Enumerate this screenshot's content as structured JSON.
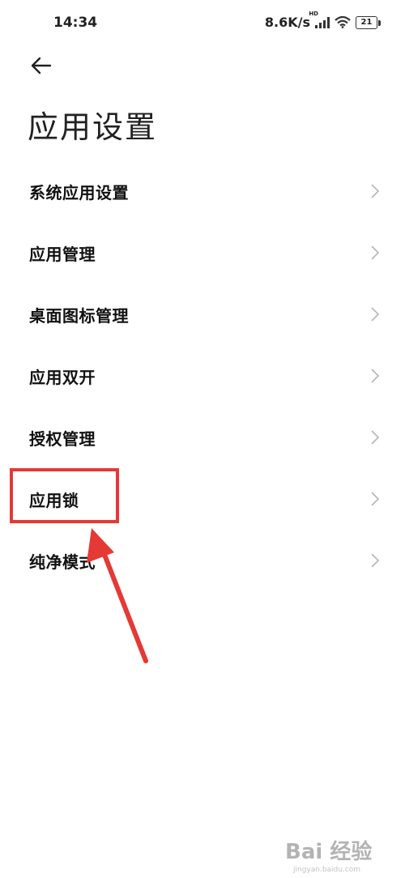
{
  "status_bar": {
    "time": "14:34",
    "net_speed": "8.6K/s",
    "hd_label": "HD",
    "battery_level": "21"
  },
  "header": {
    "back_icon": "arrow-left-icon",
    "title": "应用设置"
  },
  "menu": {
    "items": [
      {
        "label": "系统应用设置"
      },
      {
        "label": "应用管理"
      },
      {
        "label": "桌面图标管理"
      },
      {
        "label": "应用双开"
      },
      {
        "label": "授权管理"
      },
      {
        "label": "应用锁"
      },
      {
        "label": "纯净模式"
      }
    ],
    "chevron_icon": "chevron-right-icon"
  },
  "annotation": {
    "highlighted_item": "应用锁",
    "color": "#e53935"
  },
  "watermark": {
    "text": "Bai 经验",
    "subtext": "jingyan.baidu.com"
  }
}
